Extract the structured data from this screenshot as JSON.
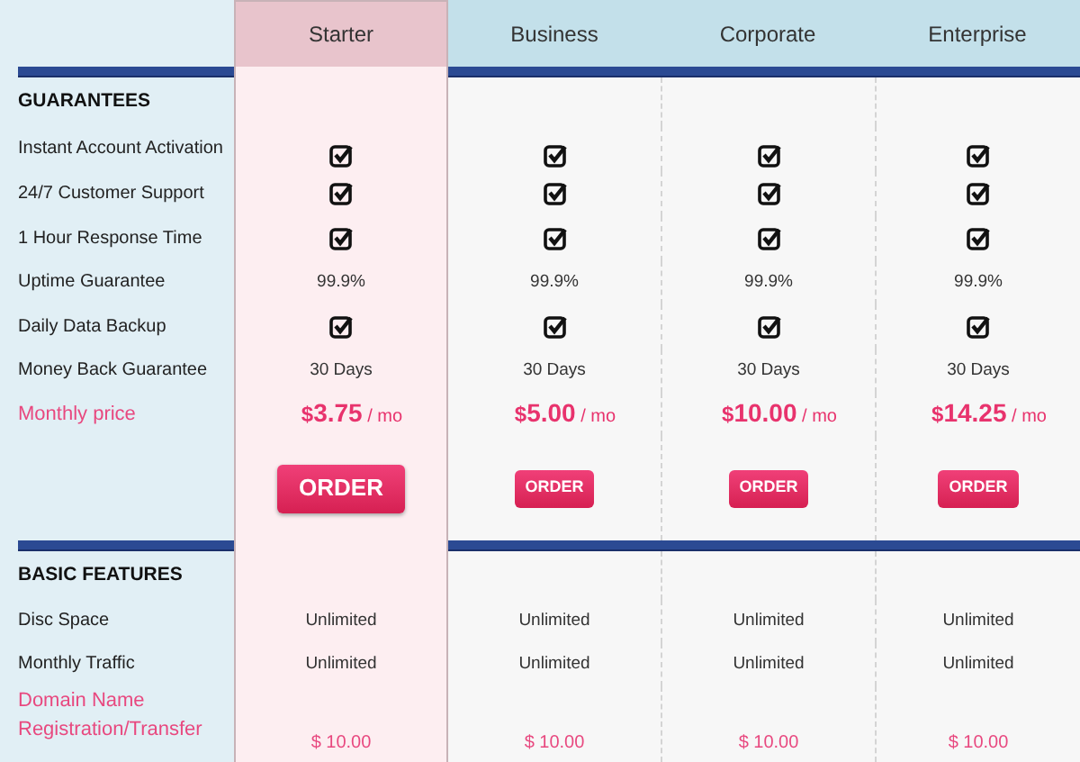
{
  "plans": [
    {
      "name": "Starter",
      "selected": true,
      "order_label": "ORDER"
    },
    {
      "name": "Business",
      "selected": false,
      "order_label": "ORDER"
    },
    {
      "name": "Corporate",
      "selected": false,
      "order_label": "ORDER"
    },
    {
      "name": "Enterprise",
      "selected": false,
      "order_label": "ORDER"
    }
  ],
  "sections": [
    {
      "title": "GUARANTEES",
      "rows": [
        {
          "label": "Instant Account Activation",
          "kind": "check",
          "cells": [
            {
              "checked": true
            },
            {
              "checked": true
            },
            {
              "checked": true
            },
            {
              "checked": true
            }
          ]
        },
        {
          "label": "24/7 Customer Support",
          "kind": "check",
          "cells": [
            {
              "checked": true
            },
            {
              "checked": true
            },
            {
              "checked": true
            },
            {
              "checked": true
            }
          ]
        },
        {
          "label": "1 Hour Response Time",
          "kind": "check",
          "cells": [
            {
              "checked": true
            },
            {
              "checked": true
            },
            {
              "checked": true
            },
            {
              "checked": true
            }
          ]
        },
        {
          "label": "Uptime Guarantee",
          "kind": "text",
          "cells": [
            {
              "text": "99.9%"
            },
            {
              "text": "99.9%"
            },
            {
              "text": "99.9%"
            },
            {
              "text": "99.9%"
            }
          ]
        },
        {
          "label": "Daily Data Backup",
          "kind": "check",
          "cells": [
            {
              "checked": true
            },
            {
              "checked": true
            },
            {
              "checked": true
            },
            {
              "checked": true
            }
          ]
        },
        {
          "label": "Money Back Guarantee",
          "kind": "text",
          "cells": [
            {
              "text": "30 Days"
            },
            {
              "text": "30 Days"
            },
            {
              "text": "30 Days"
            },
            {
              "text": "30 Days"
            }
          ]
        },
        {
          "label": "Monthly price",
          "kind": "price",
          "cells": [
            {
              "currency": "$",
              "amount": "3.75",
              "unit": "/ mo"
            },
            {
              "currency": "$",
              "amount": "5.00",
              "unit": "/ mo"
            },
            {
              "currency": "$",
              "amount": "10.00",
              "unit": "/ mo"
            },
            {
              "currency": "$",
              "amount": "14.25",
              "unit": "/ mo"
            }
          ]
        },
        {
          "kind": "order"
        }
      ]
    },
    {
      "title": "BASIC FEATURES",
      "rows": [
        {
          "label": "Disc Space",
          "kind": "text",
          "cells": [
            {
              "text": "Unlimited"
            },
            {
              "text": "Unlimited"
            },
            {
              "text": "Unlimited"
            },
            {
              "text": "Unlimited"
            }
          ]
        },
        {
          "label": "Monthly Traffic",
          "kind": "text",
          "cells": [
            {
              "text": "Unlimited"
            },
            {
              "text": "Unlimited"
            },
            {
              "text": "Unlimited"
            },
            {
              "text": "Unlimited"
            }
          ]
        },
        {
          "label": "Domain Name Registration/Transfer",
          "kind": "fee",
          "cells": [
            {
              "text": "$ 10.00"
            },
            {
              "text": "$ 10.00"
            },
            {
              "text": "$ 10.00"
            },
            {
              "text": "$ 10.00"
            }
          ]
        }
      ]
    }
  ]
}
